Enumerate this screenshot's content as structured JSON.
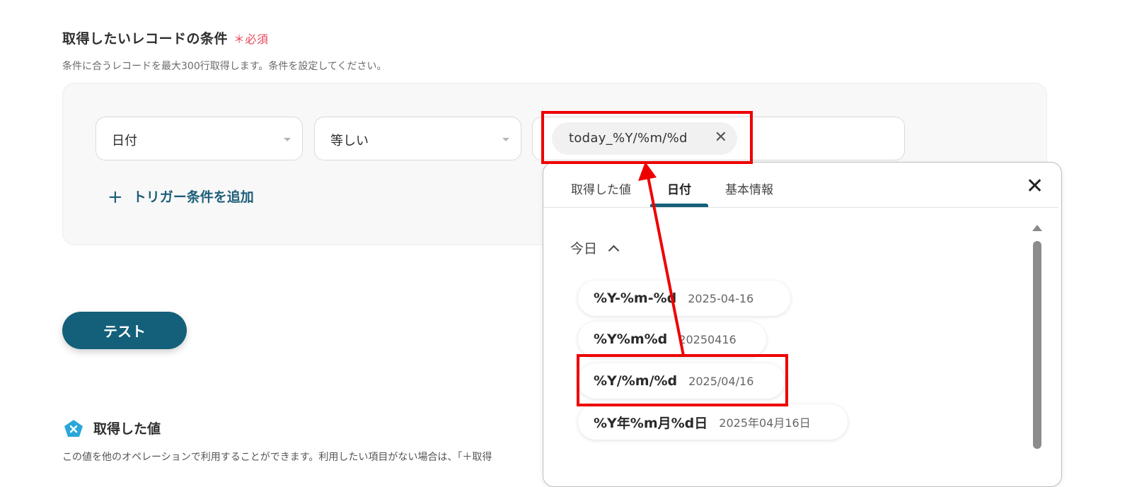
{
  "section": {
    "title": "取得したいレコードの条件",
    "required_mark": "＊必須",
    "description": "条件に合うレコードを最大300行取得します。条件を設定してください。"
  },
  "condition": {
    "field_select": "日付",
    "operator_select": "等しい",
    "value_chip": "today_%Y/%m/%d",
    "add_condition_label": "トリガー条件を追加"
  },
  "test_button": "テスト",
  "acquired": {
    "title": "取得した値",
    "description": "この値を他のオペレーションで利用することができます。利用したい項目がない場合は、「＋取得"
  },
  "popup": {
    "tabs": [
      "取得した値",
      "日付",
      "基本情報"
    ],
    "active_tab": "日付",
    "group_label": "今日",
    "options": [
      {
        "format": "%Y-%m-%d",
        "example": "2025-04-16"
      },
      {
        "format": "%Y%m%d",
        "example": "20250416"
      },
      {
        "format": "%Y/%m/%d",
        "example": "2025/04/16"
      },
      {
        "format": "%Y年%m月%d日",
        "example": "2025年04月16日"
      }
    ],
    "highlighted_option": "%Y/%m/%d"
  },
  "colors": {
    "accent": "#14607a",
    "required": "#e8455a",
    "annotation": "#ee0000"
  },
  "icons": [
    "chevron-down-icon",
    "close-icon",
    "plus-icon",
    "chevron-up-icon",
    "pentagon-x-icon"
  ]
}
